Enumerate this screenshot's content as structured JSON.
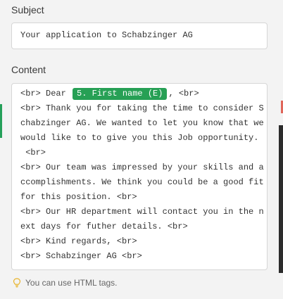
{
  "subject": {
    "label": "Subject",
    "value": "Your application to Schabzinger AG"
  },
  "content": {
    "label": "Content",
    "line1_prefix": "<br> Dear ",
    "placeholder_tag": "5. First name (E)",
    "line1_suffix": ", <br>",
    "lines": [
      "<br> Thank you for taking the time to consider S",
      "chabzinger AG. We wanted to let you know that we",
      "would like to to give you this Job opportunity.",
      " <br>",
      "<br> Our team was impressed by your skills and a",
      "ccomplishments. We think you could be a good fit",
      "for this position. <br>",
      "<br> Our HR department will contact you in the n",
      "ext days for futher details. <br>",
      "<br> Kind regards, <br>",
      "<br> Schabzinger AG <br>"
    ]
  },
  "hint": {
    "icon": "lightbulb-icon",
    "text": "You can use HTML tags."
  },
  "colors": {
    "tag_bg": "#27a055",
    "accent_red": "#e0665a"
  }
}
